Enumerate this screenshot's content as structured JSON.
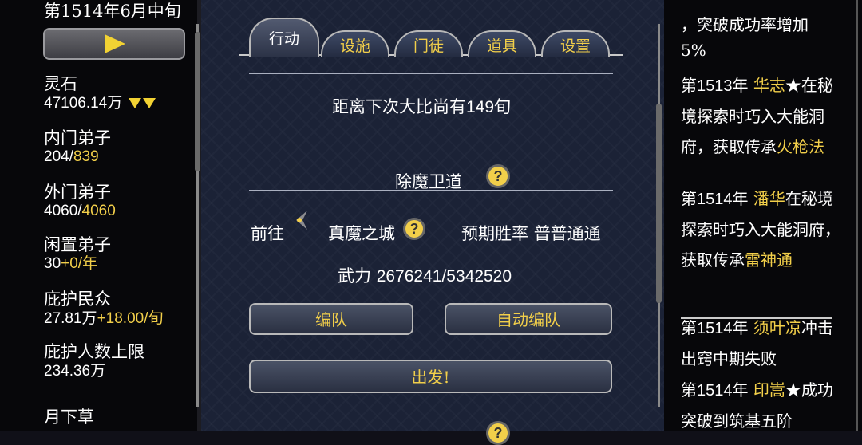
{
  "header": {
    "date": "第1514年6月中旬"
  },
  "left_panel": {
    "stats": [
      {
        "label": "灵石",
        "value": "47106.14",
        "unit": "万",
        "extra": ""
      },
      {
        "label": "内门弟子",
        "value": "204/",
        "unit": "",
        "extra": "839"
      },
      {
        "label": "外门弟子",
        "value": "4060/",
        "unit": "",
        "extra": "4060"
      },
      {
        "label": "闲置弟子",
        "value": "30",
        "unit": "",
        "extra": "+0/年"
      },
      {
        "label": "庇护民众",
        "value": "27.81",
        "unit": "万",
        "extra": "+18.00/旬"
      },
      {
        "label": "庇护人数上限",
        "value": "234.36",
        "unit": "万",
        "extra": ""
      },
      {
        "label": "月下草",
        "value": "",
        "unit": "",
        "extra": ""
      }
    ]
  },
  "tabs": [
    {
      "label": "行动",
      "active": true
    },
    {
      "label": "设施",
      "active": false
    },
    {
      "label": "门徒",
      "active": false
    },
    {
      "label": "道具",
      "active": false
    },
    {
      "label": "设置",
      "active": false
    }
  ],
  "main": {
    "countdown_prefix": "距离下次大比尚有",
    "countdown_value": "149",
    "countdown_suffix": "旬",
    "section_title": "除魔卫道",
    "goto_label": "前往",
    "goto_target": "真魔之城",
    "win_rate_label": "预期胜率",
    "win_rate_value": "普普通通",
    "power_label": "武力",
    "power_value": "2676241/5342520",
    "formation_button": "编队",
    "auto_formation_button": "自动编队",
    "depart_button": "出发!",
    "question_mark": "?"
  },
  "event_log": {
    "top_fragment_1": "，突破成功率增加",
    "top_fragment_2": "5%",
    "entries": [
      {
        "year": "第1513年",
        "name": "华志",
        "star": "★",
        "text": "在秘境探索时巧入大能洞府，获取传承",
        "item": "火枪法"
      },
      {
        "year": "第1514年",
        "name": "潘华",
        "star": "",
        "text": "在秘境探索时巧入大能洞府，获取传承",
        "item": "雷神通"
      },
      {
        "year": "第1514年",
        "name": "须叶凉",
        "star": "",
        "text": "冲击出窍中期失败",
        "item": ""
      },
      {
        "year": "第1514年",
        "name": "印嵩",
        "star": "★",
        "text": "成功突破到筑基五阶",
        "item": ""
      }
    ]
  },
  "colors": {
    "accent_gold": "#f2cf4a",
    "center_bg": "#1b2236",
    "side_bg": "#07070a"
  }
}
